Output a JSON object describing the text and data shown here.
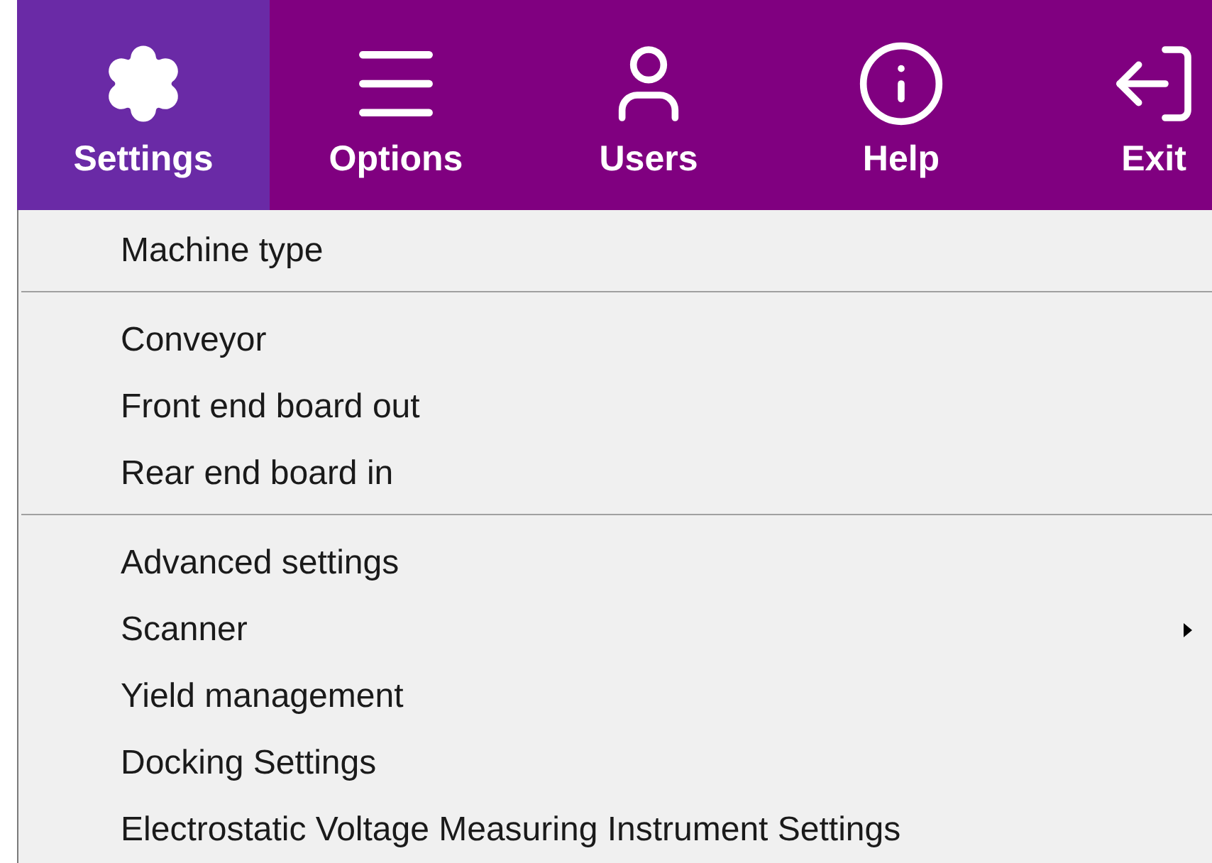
{
  "toolbar": {
    "buttons": [
      {
        "label": "Settings",
        "selected": true
      },
      {
        "label": "Options",
        "selected": false
      },
      {
        "label": "Users",
        "selected": false
      },
      {
        "label": "Help",
        "selected": false
      },
      {
        "label": "Exit",
        "selected": false
      }
    ]
  },
  "menu": {
    "groups": [
      [
        {
          "label": "Machine type",
          "submenu": false
        }
      ],
      [
        {
          "label": "Conveyor",
          "submenu": false
        },
        {
          "label": "Front end board out",
          "submenu": false
        },
        {
          "label": "Rear end board in",
          "submenu": false
        }
      ],
      [
        {
          "label": "Advanced settings",
          "submenu": false
        },
        {
          "label": "Scanner",
          "submenu": true
        },
        {
          "label": "Yield management",
          "submenu": false
        },
        {
          "label": "Docking Settings",
          "submenu": false
        },
        {
          "label": "Electrostatic Voltage Measuring Instrument Settings",
          "submenu": false
        }
      ]
    ]
  }
}
